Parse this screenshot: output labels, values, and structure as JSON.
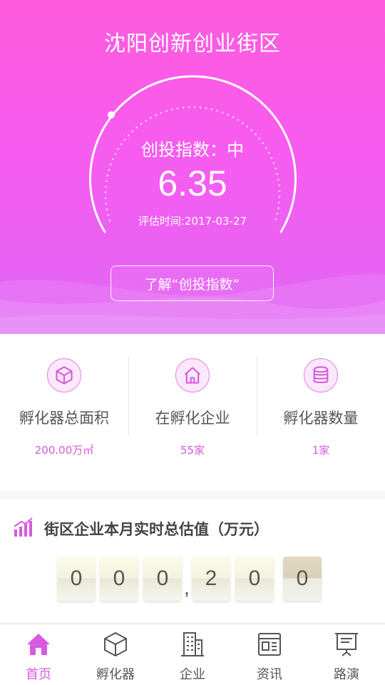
{
  "header": {
    "title": "沈阳创新创业街区"
  },
  "gauge": {
    "label": "创投指数：中",
    "value": "6.35",
    "eval_date": "评估时间:2017-03-27",
    "learn_button": "了解“创投指数”"
  },
  "stats": [
    {
      "icon": "cube-icon",
      "label": "孵化器总面积",
      "value": "200.00万㎡"
    },
    {
      "icon": "home-icon",
      "label": "在孵化企业",
      "value": "55家"
    },
    {
      "icon": "database-icon",
      "label": "孵化器数量",
      "value": "1家"
    }
  ],
  "valuation": {
    "icon": "bar-chart-icon",
    "title": "街区企业本月实时总估值（万元）",
    "digits": [
      "0",
      "0",
      "0",
      "2",
      "0",
      "0"
    ],
    "separator": ","
  },
  "tabs": [
    {
      "label": "首页",
      "icon": "home-icon",
      "active": true
    },
    {
      "label": "孵化器",
      "icon": "cube-icon",
      "active": false
    },
    {
      "label": "企业",
      "icon": "building-icon",
      "active": false
    },
    {
      "label": "资讯",
      "icon": "news-icon",
      "active": false
    },
    {
      "label": "路演",
      "icon": "presentation-icon",
      "active": false
    }
  ],
  "colors": {
    "accent": "#d75ae0",
    "hero_top": "#ff5cdd",
    "hero_bottom": "#e066f5"
  }
}
